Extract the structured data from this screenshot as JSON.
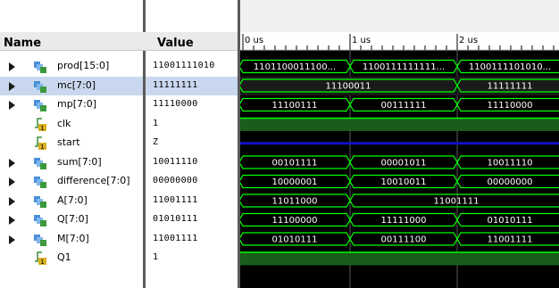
{
  "columns": {
    "name": "Name",
    "value": "Value"
  },
  "time_labels": [
    "0 us",
    "1 us",
    "2 us"
  ],
  "signals": [
    {
      "name": "prod[15:0]",
      "value": "11001111010",
      "kind": "bus",
      "icon": "bus-icon",
      "expandable": true,
      "segments": [
        "1101100011100...",
        "1100111111111...",
        "1100111101010..."
      ]
    },
    {
      "name": "mc[7:0]",
      "value": "11111111",
      "kind": "bus",
      "icon": "bus-icon",
      "expandable": true,
      "selected": true,
      "segments": [
        "11100011",
        "11111111"
      ]
    },
    {
      "name": "mp[7:0]",
      "value": "11110000",
      "kind": "bus",
      "icon": "bus-icon",
      "expandable": true,
      "segments": [
        "11100111",
        "00111111",
        "11110000"
      ]
    },
    {
      "name": "clk",
      "value": "1",
      "kind": "bit",
      "icon": "bit-icon",
      "expandable": false
    },
    {
      "name": "start",
      "value": "Z",
      "kind": "hiz",
      "icon": "bit-icon",
      "expandable": false
    },
    {
      "name": "sum[7:0]",
      "value": "10011110",
      "kind": "bus",
      "icon": "bus-icon",
      "expandable": true,
      "segments": [
        "00101111",
        "00001011",
        "10011110"
      ]
    },
    {
      "name": "difference[7:0]",
      "value": "00000000",
      "kind": "bus",
      "icon": "bus-icon",
      "expandable": true,
      "segments": [
        "10000001",
        "10010011",
        "00000000"
      ]
    },
    {
      "name": "A[7:0]",
      "value": "11001111",
      "kind": "bus",
      "icon": "bus-icon",
      "expandable": true,
      "segments": [
        "11011000",
        "11001111"
      ]
    },
    {
      "name": "Q[7:0]",
      "value": "01010111",
      "kind": "bus",
      "icon": "bus-icon",
      "expandable": true,
      "segments": [
        "11100000",
        "11111000",
        "01010111"
      ]
    },
    {
      "name": "M[7:0]",
      "value": "11001111",
      "kind": "bus",
      "icon": "bus-icon",
      "expandable": true,
      "segments": [
        "01010111",
        "00111100",
        "11001111"
      ]
    },
    {
      "name": "Q1",
      "value": "1",
      "kind": "bit",
      "icon": "bit-icon",
      "expandable": false
    }
  ],
  "colors": {
    "wave": "#00ff00",
    "wave_text": "#ffffff",
    "hiz": "#1010c8",
    "high_fill": "#1a5c1a",
    "background": "#000000"
  }
}
